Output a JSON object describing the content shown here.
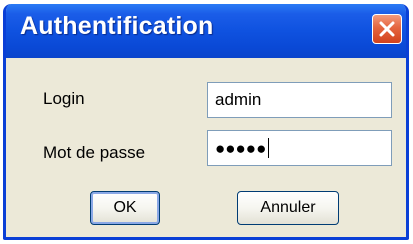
{
  "dialog": {
    "title": "Authentification",
    "close_icon": "close-icon"
  },
  "form": {
    "login_label": "Login",
    "login_value": "admin",
    "password_label": "Mot de passe",
    "password_value": "●●●●●"
  },
  "buttons": {
    "ok_label": "OK",
    "cancel_label": "Annuler"
  },
  "colors": {
    "titlebar": "#0f52e0",
    "window_bg": "#ece9d8",
    "close_button": "#d2421c",
    "field_border": "#7f9db9"
  }
}
